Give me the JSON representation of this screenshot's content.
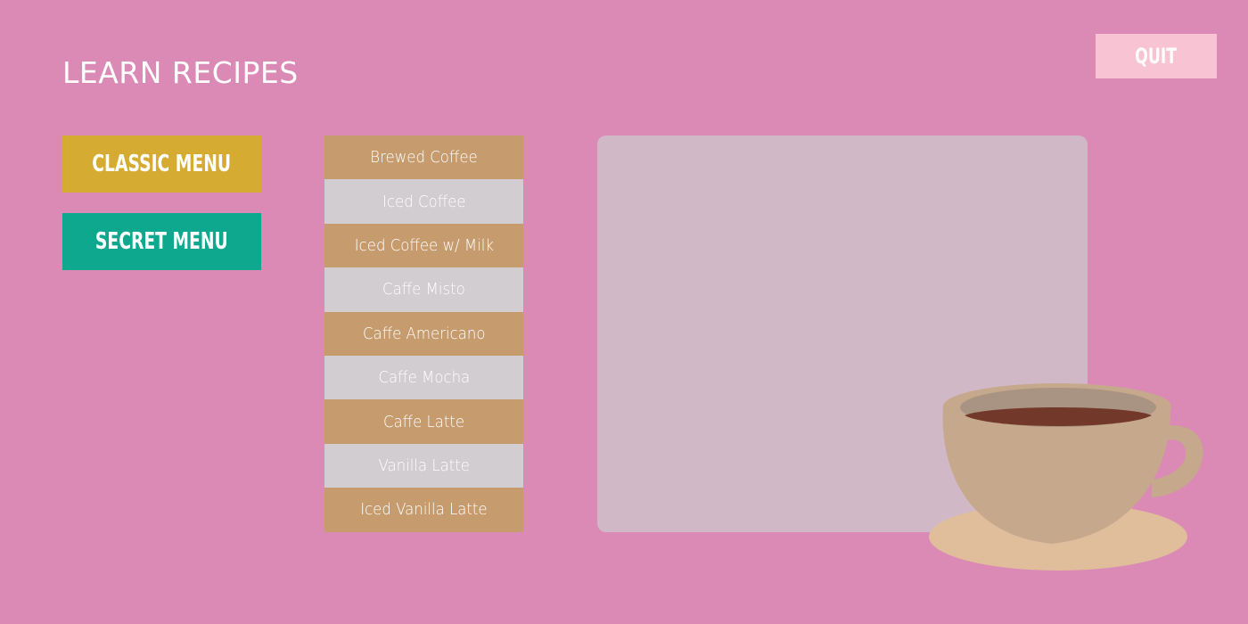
{
  "page": {
    "title": "LEARN RECIPES",
    "background_color": "#da8ab5"
  },
  "quit": {
    "label": "QUIT",
    "color": "#f8c3d3"
  },
  "menus": {
    "classic": {
      "label": "CLASSIC MENU",
      "color": "#d6ab31"
    },
    "secret": {
      "label": "SECRET MENU",
      "color": "#0ea88f"
    }
  },
  "recipes": [
    {
      "label": "Brewed Coffee",
      "color": "#c69b6e"
    },
    {
      "label": "Iced Coffee",
      "color": "#d1cdd0"
    },
    {
      "label": "Iced Coffee w/ Milk",
      "color": "#c69b6e"
    },
    {
      "label": "Caffe Misto",
      "color": "#d1cdd0"
    },
    {
      "label": "Caffe Americano",
      "color": "#c69b6e"
    },
    {
      "label": "Caffe Mocha",
      "color": "#d1cdd0"
    },
    {
      "label": "Caffe Latte",
      "color": "#c69b6e"
    },
    {
      "label": "Vanilla Latte",
      "color": "#d1cdd0"
    },
    {
      "label": "Iced Vanilla Latte",
      "color": "#c69b6e"
    }
  ],
  "recipe_panel": {
    "color": "#d0b8c7"
  },
  "illustration": {
    "icon": "coffee-cup-icon",
    "cup_color": "#c6a98c",
    "saucer_color": "#e0bd9b",
    "coffee_color": "#72392b",
    "rim_color": "#a99382"
  }
}
